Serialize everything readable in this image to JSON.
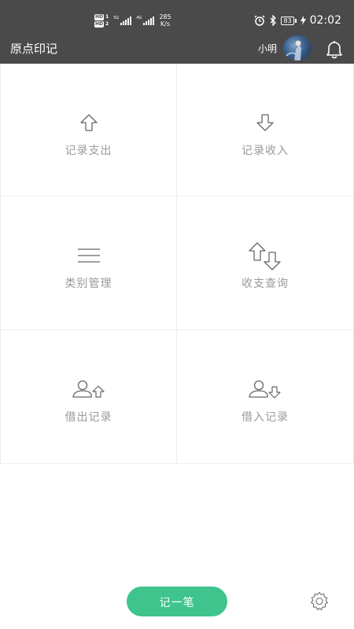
{
  "status_bar": {
    "hd1": "HD",
    "hd1_sim": "1",
    "hd2": "HD",
    "hd2_sim": "2",
    "sig1_tag": "5G",
    "sig2_tag": "4G",
    "speed_value": "285",
    "speed_unit": "K/s",
    "battery": "83",
    "time": "02:02",
    "icons": [
      "alarm-icon",
      "bluetooth-icon",
      "battery-icon",
      "charging-icon"
    ]
  },
  "app_bar": {
    "title": "原点印记",
    "user_name": "小明",
    "icons": [
      "avatar",
      "bell-icon"
    ]
  },
  "menu": {
    "items": [
      {
        "label": "记录支出",
        "icon": "arrow-up-icon"
      },
      {
        "label": "记录收入",
        "icon": "arrow-down-icon"
      },
      {
        "label": "类别管理",
        "icon": "menu-lines-icon"
      },
      {
        "label": "收支查询",
        "icon": "swap-arrows-icon"
      },
      {
        "label": "借出记录",
        "icon": "user-arrow-up-icon"
      },
      {
        "label": "借入记录",
        "icon": "user-arrow-down-icon"
      }
    ]
  },
  "bottom": {
    "record_button": "记一笔",
    "settings_icon": "gear-icon"
  },
  "colors": {
    "header_bg": "#4a4a4a",
    "accent": "#3ec48c",
    "label_gray": "#9a9a9a",
    "divider": "#eeeeee"
  }
}
